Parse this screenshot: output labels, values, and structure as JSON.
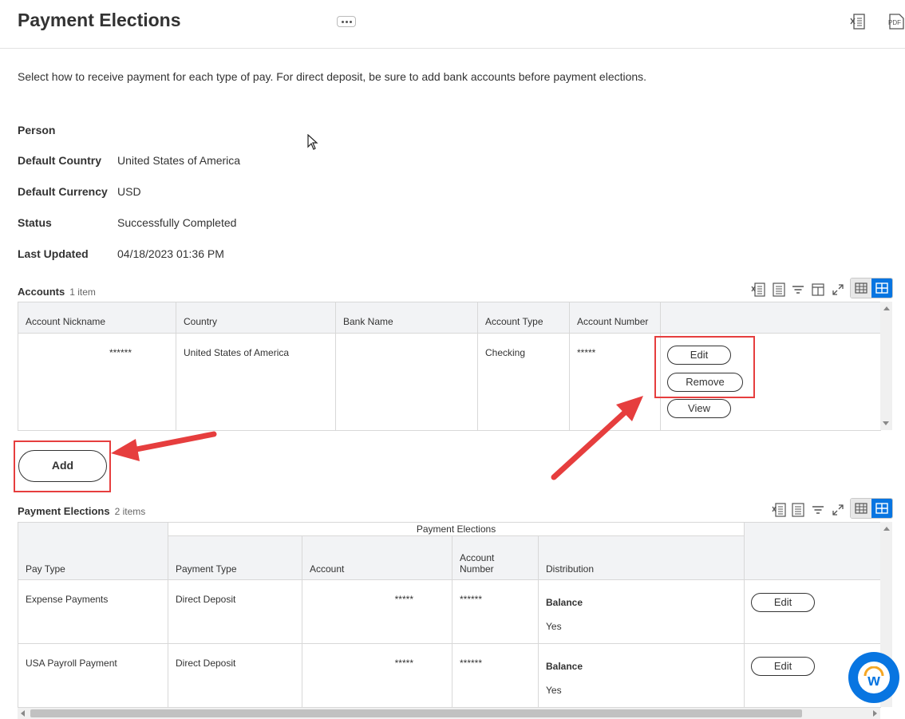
{
  "page": {
    "title": "Payment Elections",
    "intro": "Select how to receive payment for each type of pay. For direct deposit, be sure to add bank accounts before payment elections.",
    "header_icons": {
      "export_excel": "excel-export-icon",
      "export_pdf": "pdf-export-icon",
      "related_actions": "related-actions-icon"
    },
    "pdf_label": "PDF"
  },
  "fields": [
    {
      "label": "Person",
      "value": ""
    },
    {
      "label": "Default Country",
      "value": "United States of America"
    },
    {
      "label": "Default Currency",
      "value": "USD"
    },
    {
      "label": "Status",
      "value": "Successfully Completed"
    },
    {
      "label": "Last Updated",
      "value": "04/18/2023 01:36 PM"
    }
  ],
  "accounts": {
    "title": "Accounts",
    "count": "1 item",
    "columns": [
      "Account Nickname",
      "Country",
      "Bank Name",
      "Account Type",
      "Account Number"
    ],
    "rows": [
      {
        "nickname": "******",
        "country": "United States of America",
        "bank": "",
        "type": "Checking",
        "number": "*****"
      }
    ],
    "actions": {
      "edit": "Edit",
      "remove": "Remove",
      "view": "View"
    },
    "add_label": "Add"
  },
  "elections": {
    "title": "Payment Elections",
    "count": "2 items",
    "group_header": "Payment Elections",
    "columns": [
      "Pay Type",
      "Payment Type",
      "Account",
      "Account Number",
      "Distribution"
    ],
    "rows": [
      {
        "pay_type": "Expense Payments",
        "payment_type": "Direct Deposit",
        "account": "*****",
        "account_number": "******",
        "dist_label": "Balance",
        "dist_value": "Yes",
        "action": "Edit"
      },
      {
        "pay_type": "USA Payroll Payment",
        "payment_type": "Direct Deposit",
        "account": "*****",
        "account_number": "******",
        "dist_label": "Balance",
        "dist_value": "Yes",
        "action": "Edit"
      }
    ]
  },
  "assistant": {
    "letter": "w"
  },
  "colors": {
    "accent": "#0875e1",
    "annotation": "#e63e3e",
    "header_bg": "#f2f3f5"
  }
}
